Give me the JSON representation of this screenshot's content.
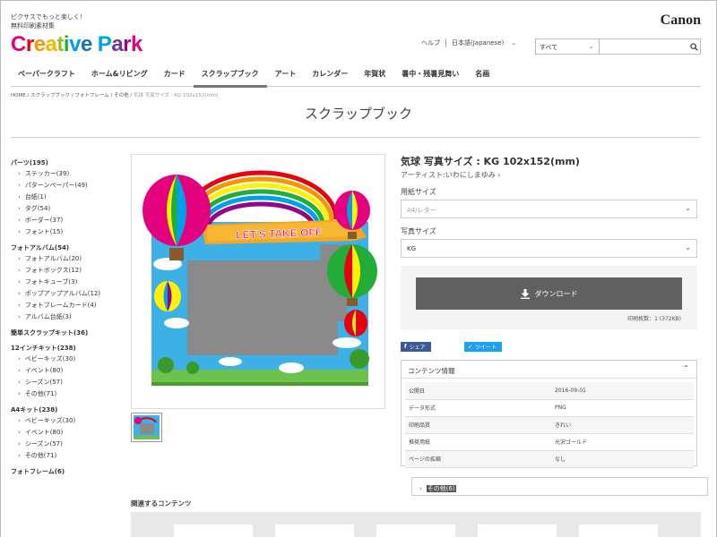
{
  "header": {
    "tagline_line1": "ピクサスでもっと楽しく！",
    "tagline_line2": "無料印刷素材集",
    "logo_letters": [
      {
        "ch": "C",
        "color": "#e4007f"
      },
      {
        "ch": "r",
        "color": "#e60012"
      },
      {
        "ch": "e",
        "color": "#f39800"
      },
      {
        "ch": "a",
        "color": "#f5b800"
      },
      {
        "ch": "t",
        "color": "#8fc31f"
      },
      {
        "ch": "i",
        "color": "#22ac38"
      },
      {
        "ch": "v",
        "color": "#00a0e9"
      },
      {
        "ch": "e",
        "color": "#1d6fb8"
      },
      {
        "ch": " ",
        "color": "#fff"
      },
      {
        "ch": "P",
        "color": "#00a0e9"
      },
      {
        "ch": "a",
        "color": "#6a3a98"
      },
      {
        "ch": "r",
        "color": "#920783"
      },
      {
        "ch": "k",
        "color": "#e4007f"
      }
    ],
    "brand": "Canon",
    "help": "ヘルプ",
    "language": "日本語(Japanese)",
    "search_category": "すべて",
    "search_placeholder": ""
  },
  "nav": [
    "ペーパークラフト",
    "ホーム&リビング",
    "カード",
    "スクラップブック",
    "アート",
    "カレンダー",
    "年賀状",
    "暑中・残暑見舞い",
    "名画"
  ],
  "nav_active_index": 3,
  "breadcrumb": {
    "items": [
      "HOME",
      "スクラップブック",
      "フォトフレーム",
      "その他"
    ],
    "current": "気球 写真サイズ : KG 102x152(mm)"
  },
  "page_title": "スクラップブック",
  "sidebar": [
    {
      "label": "パーツ(195)",
      "items": [
        "ステッカー(39)",
        "パターンペーパー(49)",
        "台紙(1)",
        "タグ(54)",
        "ボーダー(37)",
        "フォント(15)"
      ]
    },
    {
      "label": "フォトアルバム(54)",
      "items": [
        "フォトアルバム(20)",
        "フォトボックス(12)",
        "フォトキューブ(3)",
        "ポップアップアルバム(12)",
        "フォトフレームカード(4)",
        "アルバム台紙(3)"
      ]
    },
    {
      "label": "簡単スクラップキット(36)",
      "items": []
    },
    {
      "label": "12インチキット(238)",
      "items": [
        "ベビーキッズ(30)",
        "イベント(80)",
        "シーズン(57)",
        "その他(71)"
      ]
    },
    {
      "label": "A4キット(238)",
      "items": [
        "ベビーキッズ(30)",
        "イベント(80)",
        "シーズン(57)",
        "その他(71)"
      ]
    },
    {
      "label": "フォトフレーム(6)",
      "items": [
        "その他(6)"
      ]
    }
  ],
  "product": {
    "title": "気球 写真サイズ : KG 102x152(mm)",
    "artist": "アーティスト:いわにしまゆみ",
    "banner_text": "LET'S TAKE OFF",
    "paper_size_label": "用紙サイズ",
    "paper_size_value": "A4/レター",
    "photo_size_label": "写真サイズ",
    "photo_size_value": "KG",
    "download_label": "ダウンロード",
    "print_count": "印刷枚数：1 (372KB)",
    "share_facebook": "シェア",
    "share_twitter": "ツイート"
  },
  "info": {
    "title": "コンテンツ情報",
    "rows": [
      {
        "k": "公開日",
        "v": "2016-09-01"
      },
      {
        "k": "データ形式",
        "v": "PNG"
      },
      {
        "k": "印刷品質",
        "v": "きれい"
      },
      {
        "k": "推奨用紙",
        "v": "光沢ゴールド"
      },
      {
        "k": "ページの拡縮",
        "v": "なし"
      }
    ]
  },
  "related_title": "関連するコンテンツ",
  "icons": {
    "search": "search-icon",
    "download": "download-arrow-icon",
    "collapse": "chevron-up-icon",
    "dropdown": "chevron-down-icon"
  }
}
